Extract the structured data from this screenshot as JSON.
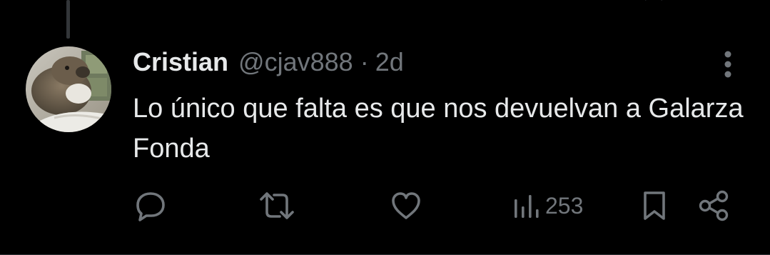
{
  "tweet": {
    "author": {
      "name": "Cristian",
      "handle": "@cjav888"
    },
    "separator": "·",
    "time": "2d",
    "text": "Lo único que falta es que nos devuelvan a Galarza Fonda",
    "views": "253"
  },
  "icons": {
    "reply": "reply-icon",
    "retweet": "retweet-icon",
    "like": "heart-icon",
    "views": "bar-chart-icon",
    "bookmark": "bookmark-icon",
    "share": "share-icon",
    "more": "more-vertical-icon"
  },
  "colors": {
    "background": "#000000",
    "text": "#e7e9ea",
    "secondary": "#71767b",
    "divider": "#2f3336"
  }
}
